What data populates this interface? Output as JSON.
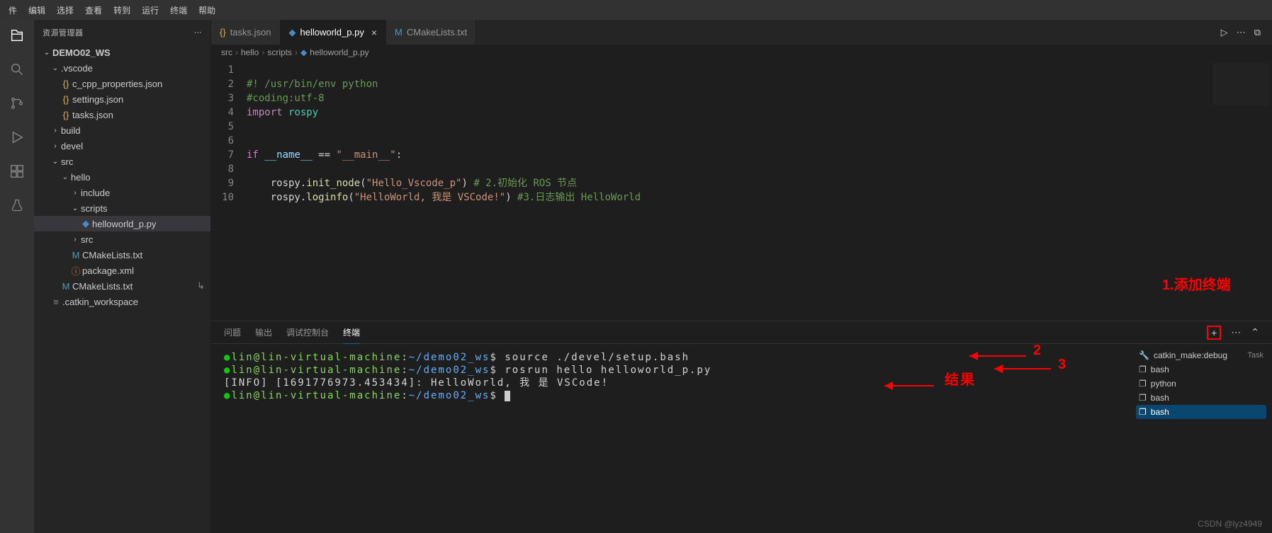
{
  "menubar": [
    "件",
    "编辑",
    "选择",
    "查看",
    "转到",
    "运行",
    "终端",
    "帮助"
  ],
  "sidebar_title": "资源管理器",
  "root": "DEMO02_WS",
  "tree": {
    "vscode": ".vscode",
    "ccpp": "c_cpp_properties.json",
    "settings": "settings.json",
    "tasksjson": "tasks.json",
    "build": "build",
    "devel": "devel",
    "src": "src",
    "hello": "hello",
    "include": "include",
    "scripts": "scripts",
    "hw": "helloworld_p.py",
    "srcinner": "src",
    "cmake1": "CMakeLists.txt",
    "pkg": "package.xml",
    "cmake2": "CMakeLists.txt",
    "catkin": ".catkin_workspace"
  },
  "tabs": [
    {
      "label": "tasks.json",
      "icon": "json"
    },
    {
      "label": "helloworld_p.py",
      "icon": "py",
      "active": true,
      "close": "×"
    },
    {
      "label": "CMakeLists.txt",
      "icon": "txt"
    }
  ],
  "breadcrumb": [
    "src",
    "hello",
    "scripts",
    "helloworld_p.py"
  ],
  "code_lines": [
    1,
    2,
    3,
    4,
    5,
    6,
    7,
    8,
    9,
    10
  ],
  "code": {
    "l1": "#! /usr/bin/env python",
    "l2": "#coding:utf-8",
    "l3a": "import ",
    "l3b": "rospy",
    "l6a": "if ",
    "l6b": "__name__",
    "l6c": " == ",
    "l6d": "\"__main__\"",
    "l6e": ":",
    "l8a": "rospy.",
    "l8b": "init_node",
    "l8c": "(",
    "l8d": "\"Hello_Vscode_p\"",
    "l8e": ") ",
    "l8f": "# 2.初始化 ROS 节点",
    "l9a": "rospy.",
    "l9b": "loginfo",
    "l9c": "(",
    "l9d": "\"HelloWorld, 我是 VSCode!\"",
    "l9e": ") ",
    "l9f": "#3.日志输出 HelloWorld"
  },
  "panel_tabs": [
    "问题",
    "输出",
    "调试控制台",
    "终端"
  ],
  "terminal": {
    "prompt_user": "lin@lin-virtual-machine",
    "prompt_sep": ":",
    "prompt_path": "~/demo02_ws",
    "prompt_dollar": "$",
    "cmd1": "source ./devel/setup.bash",
    "cmd2": "rosrun hello helloworld_p.py",
    "info": "[INFO] [1691776973.453434]: HelloWorld, 我 是 VSCode!"
  },
  "term_side": [
    {
      "icon": "tool",
      "label": "catkin_make:debug",
      "right": "Task"
    },
    {
      "icon": "term",
      "label": "bash"
    },
    {
      "icon": "term",
      "label": "python"
    },
    {
      "icon": "term",
      "label": "bash"
    },
    {
      "icon": "term",
      "label": "bash",
      "active": true
    }
  ],
  "annotations": {
    "a1": "1.添加终端",
    "a2": "2",
    "a3": "3",
    "res": "结果"
  },
  "watermark": "CSDN @lyz4949"
}
